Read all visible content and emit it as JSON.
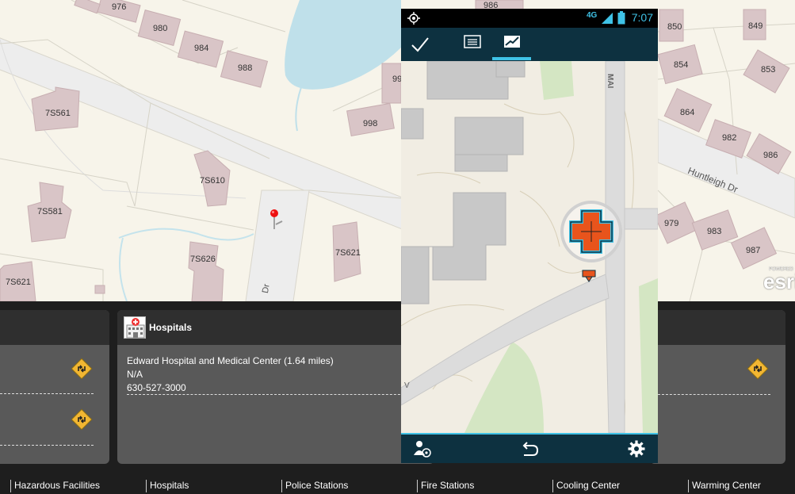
{
  "map": {
    "parcels": [
      "976",
      "980",
      "984",
      "988",
      "7S561",
      "7S610",
      "7S581",
      "7S626",
      "7S621",
      "7S621",
      "998",
      "99",
      "986",
      "850",
      "849",
      "854",
      "853",
      "864",
      "982",
      "986",
      "979",
      "983",
      "987"
    ],
    "road_labels": [
      "Huntleigh Dr",
      "Dr",
      "MAI",
      "V"
    ]
  },
  "phone": {
    "status_time": "7:07",
    "network_label": "4G"
  },
  "cards": {
    "hospitals": {
      "title": "Hospitals",
      "name": "Edward Hospital and Medical Center (1.64 miles)",
      "address": "N/A",
      "phone": "630-527-3000"
    }
  },
  "tabs": [
    "Hazardous Facilities",
    "Hospitals",
    "Police Stations",
    "Fire Stations",
    "Cooling Center",
    "Warming Center"
  ],
  "brand": {
    "esri": "esri",
    "powered": "POWERED"
  },
  "colors": {
    "accent": "#3fc2e6",
    "navy": "#0d3140",
    "marker": "#e8541c",
    "directions": "#f2b632"
  }
}
